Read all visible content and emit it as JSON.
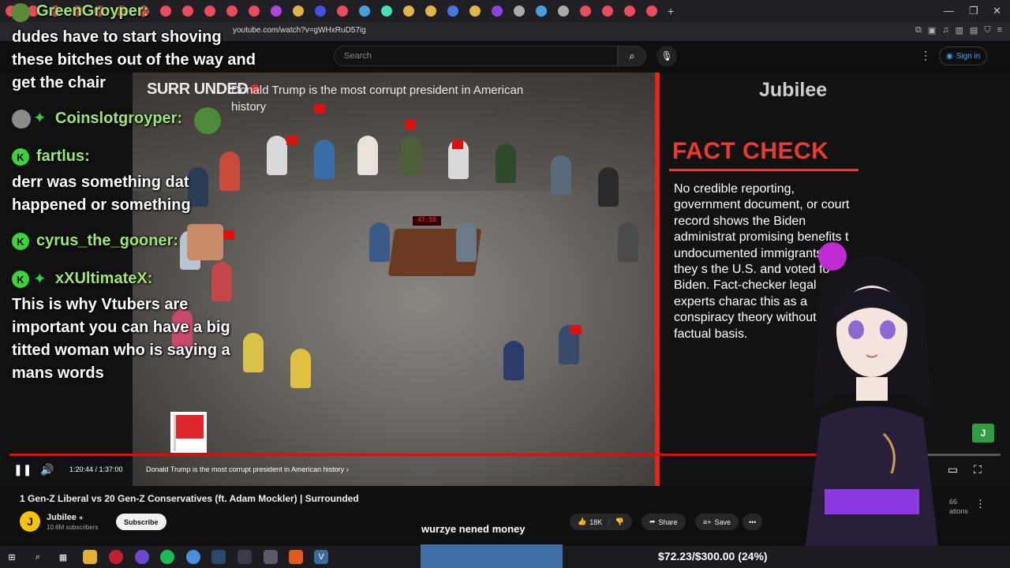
{
  "browser": {
    "url": "youtube.com/watch?v=gWHxRuD57ig",
    "window_controls": [
      "—",
      "❐",
      "✕"
    ]
  },
  "youtube": {
    "search_placeholder": "Search",
    "sign_in": "Sign in"
  },
  "video": {
    "show_logo": "SURR UNDED",
    "topic": "Donald Trump is the most corrupt president in American history",
    "brand": "Jubilee",
    "fact_check_title": "FACT CHECK",
    "fact_check_body": "No credible reporting, government document, or court record shows the Biden administrat promising benefits t undocumented immigrants if they s the U.S. and voted fo Biden. Fact-checker legal experts charac this as a conspiracy theory without factual basis.",
    "clock_text": "47:58",
    "progress_fraction": 0.8267,
    "time_display": "1:20:44 / 1:37:00",
    "chapter": "Donald Trump is the most corrupt president in American history",
    "chapter_arrow": "›"
  },
  "chat": {
    "messages": [
      {
        "user": "GreenGroyper:",
        "text": [
          "dudes have to start shoving",
          "these bitches out of the way and",
          "get the chair"
        ]
      },
      {
        "user": "Coinslotgroyper:",
        "text": []
      },
      {
        "user": "fartlus:",
        "text": [
          "derr was something dat",
          "happened or something"
        ]
      },
      {
        "user": "cyrus_the_gooner:",
        "text": []
      },
      {
        "user": "xXUltimateX:",
        "text": [
          "This is why Vtubers are",
          "important you can have a big",
          "titted woman who is saying a",
          "mans words"
        ]
      }
    ],
    "badge_k": "K"
  },
  "below": {
    "title": "1 Gen-Z Liberal vs 20 Gen-Z Conservatives (ft. Adam Mockler) | Surrounded",
    "channel": "Jubilee",
    "channel_initial": "J",
    "subscribers": "10.6M subscribers",
    "subscribe": "Subscribe",
    "likes": "18K",
    "share": "Share",
    "save": "Save",
    "caption": "wurzye nened money",
    "views_partial": "66",
    "views_suffix": "ations"
  },
  "taskbar": {
    "donation": "$72.23/$300.00 (24%)"
  },
  "colors": {
    "accent_red": "#ec3a2c",
    "chat_name_green": "#9fe870",
    "progress_red": "#ff0000",
    "donation_blue": "#3e6ea3"
  }
}
